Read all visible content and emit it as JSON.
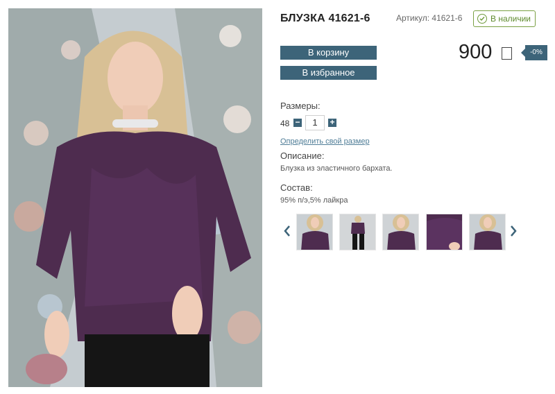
{
  "product": {
    "title": "БЛУЗКА 41621-6",
    "article": "Артикул: 41621-6",
    "stock": "В наличии",
    "price": "900",
    "discount": "-0%"
  },
  "actions": {
    "cart": "В корзину",
    "favorite": "В избранное"
  },
  "sizes": {
    "label": "Размеры:",
    "value": "48",
    "quantity": "1",
    "minus": "−",
    "plus": "+",
    "link": "Определить свой размер"
  },
  "description": {
    "label": "Описание:",
    "text": "Блузка из эластичного бархата."
  },
  "composition": {
    "label": "Состав:",
    "text": "95% п/э,5% лайкра"
  },
  "colors": {
    "accent": "#3d6479",
    "stock": "#6e9a3a"
  },
  "icons": {
    "stock": "check-circle-icon",
    "currency": "ruble-box-icon",
    "prev": "chevron-left-icon",
    "next": "chevron-right-icon"
  }
}
